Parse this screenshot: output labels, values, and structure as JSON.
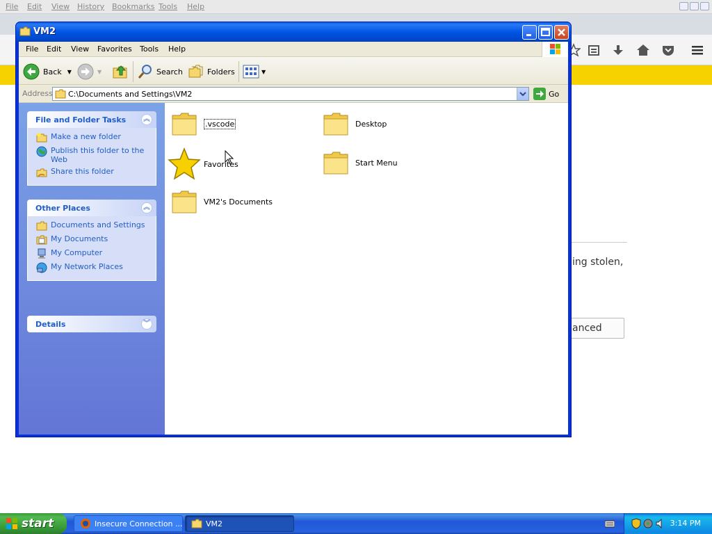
{
  "firefox": {
    "menu": [
      "File",
      "Edit",
      "View",
      "History",
      "Bookmarks",
      "Tools",
      "Help"
    ],
    "page_text": "ing stolen,",
    "advanced_label": "anced"
  },
  "window": {
    "title": "VM2",
    "menu": [
      "File",
      "Edit",
      "View",
      "Favorites",
      "Tools",
      "Help"
    ],
    "toolbar": {
      "back": "Back",
      "search": "Search",
      "folders": "Folders"
    },
    "address": {
      "label": "Address",
      "value": "C:\\Documents and Settings\\VM2",
      "go": "Go"
    },
    "tasks": {
      "title": "File and Folder Tasks",
      "items": [
        "Make a new folder",
        "Publish this folder to the Web",
        "Share this folder"
      ]
    },
    "other_places": {
      "title": "Other Places",
      "items": [
        "Documents and Settings",
        "My Documents",
        "My Computer",
        "My Network Places"
      ]
    },
    "details": {
      "title": "Details"
    },
    "files": [
      ".vscode",
      "Desktop",
      "Favorites",
      "Start Menu",
      "VM2's Documents"
    ]
  },
  "taskbar": {
    "start": "start",
    "tasks": [
      "Insecure Connection ...",
      "VM2"
    ],
    "clock": "3:14 PM"
  },
  "colors": {
    "xp_blue": "#0831d9",
    "link_blue": "#215dc6",
    "start_green": "#379937"
  }
}
